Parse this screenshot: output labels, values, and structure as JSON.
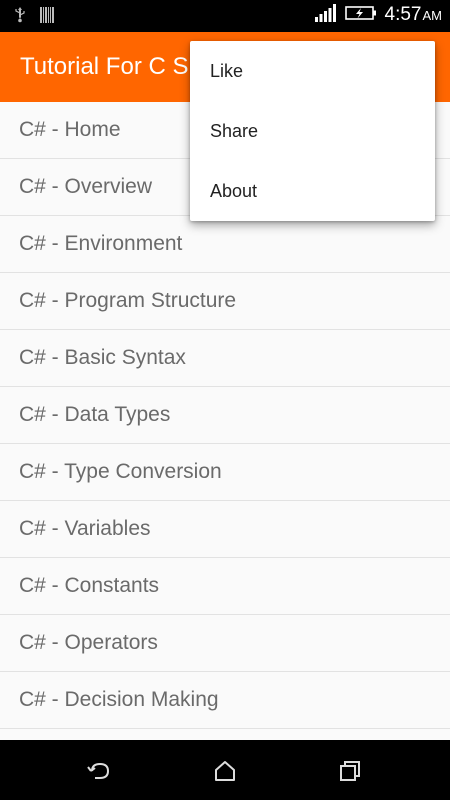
{
  "status_bar": {
    "time": "4:57",
    "ampm": "AM",
    "icons": [
      "usb-icon",
      "barcode-icon",
      "signal-icon",
      "battery-charging-icon"
    ]
  },
  "app_bar": {
    "title": "Tutorial For C Sharp"
  },
  "list": {
    "items": [
      "C# - Home",
      "C# - Overview",
      "C# - Environment",
      "C# - Program Structure",
      "C# - Basic Syntax",
      "C# - Data Types",
      "C# - Type Conversion",
      "C# - Variables",
      "C# - Constants",
      "C# - Operators",
      "C# - Decision Making"
    ]
  },
  "overflow_menu": {
    "items": [
      "Like",
      "Share",
      "About"
    ]
  },
  "nav_bar": {
    "buttons": [
      "back-icon",
      "home-icon",
      "recent-apps-icon"
    ]
  },
  "colors": {
    "accent": "#ff6600",
    "list_text": "#6a6a6a",
    "divider": "#e2e2e2"
  }
}
